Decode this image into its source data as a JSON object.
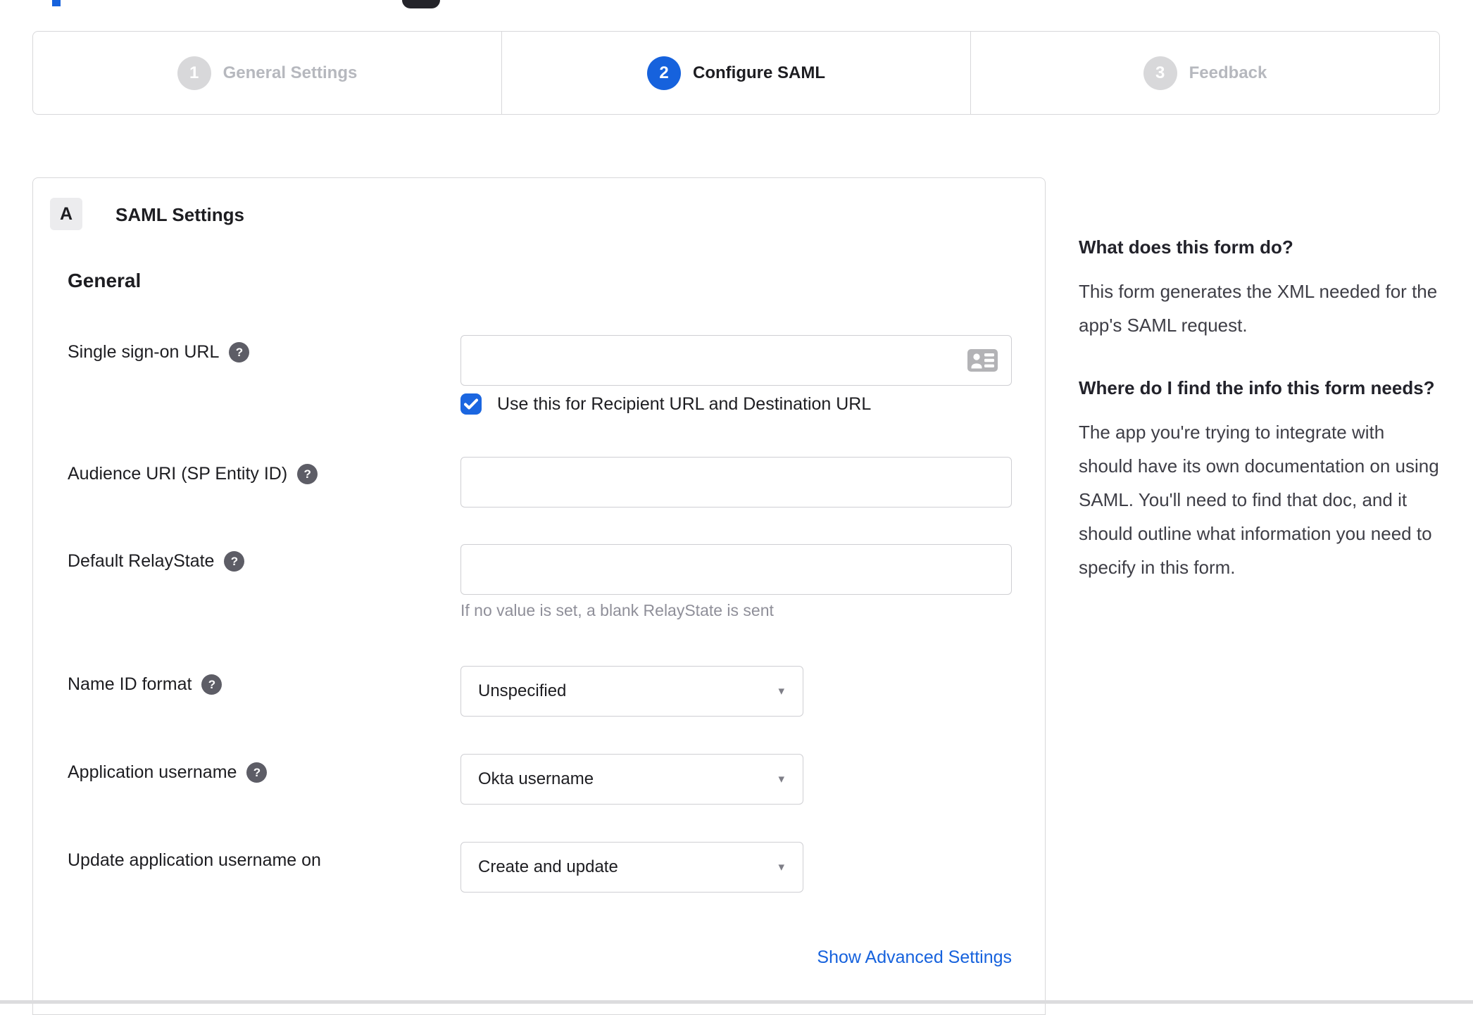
{
  "colors": {
    "accent_blue": "#1662dd",
    "border_gray": "#d8d8da",
    "text_dark": "#1d1d21",
    "inactive_gray": "#b6b8be",
    "helper_gray": "#8f8f99",
    "icon_gray": "#b3b3b6"
  },
  "icons": {
    "help_glyph": "?",
    "caret_glyph": "▾"
  },
  "stepper": {
    "steps": [
      {
        "number": "1",
        "label": "General Settings",
        "state": "inactive"
      },
      {
        "number": "2",
        "label": "Configure SAML",
        "state": "active"
      },
      {
        "number": "3",
        "label": "Feedback",
        "state": "inactive"
      }
    ]
  },
  "panel": {
    "section_badge": "A",
    "section_title": "SAML Settings",
    "group_heading": "General",
    "fields": {
      "sso": {
        "label": "Single sign-on URL",
        "value": "",
        "checkbox_label": "Use this for Recipient URL and Destination URL",
        "checkbox_checked": true
      },
      "audience": {
        "label": "Audience URI (SP Entity ID)",
        "value": ""
      },
      "relay": {
        "label": "Default RelayState",
        "value": "",
        "helper": "If no value is set, a blank RelayState is sent"
      },
      "name_id": {
        "label": "Name ID format",
        "value": "Unspecified"
      },
      "app_username": {
        "label": "Application username",
        "value": "Okta username"
      },
      "update_username": {
        "label": "Update application username on",
        "value": "Create and update"
      }
    },
    "advanced_link": "Show Advanced Settings"
  },
  "sidebar": {
    "heading1": "What does this form do?",
    "para1": "This form generates the XML needed for the app's SAML request.",
    "heading2": "Where do I find the info this form needs?",
    "para2": "The app you're trying to integrate with should have its own documentation on using SAML. You'll need to find that doc, and it should outline what information you need to specify in this form."
  }
}
